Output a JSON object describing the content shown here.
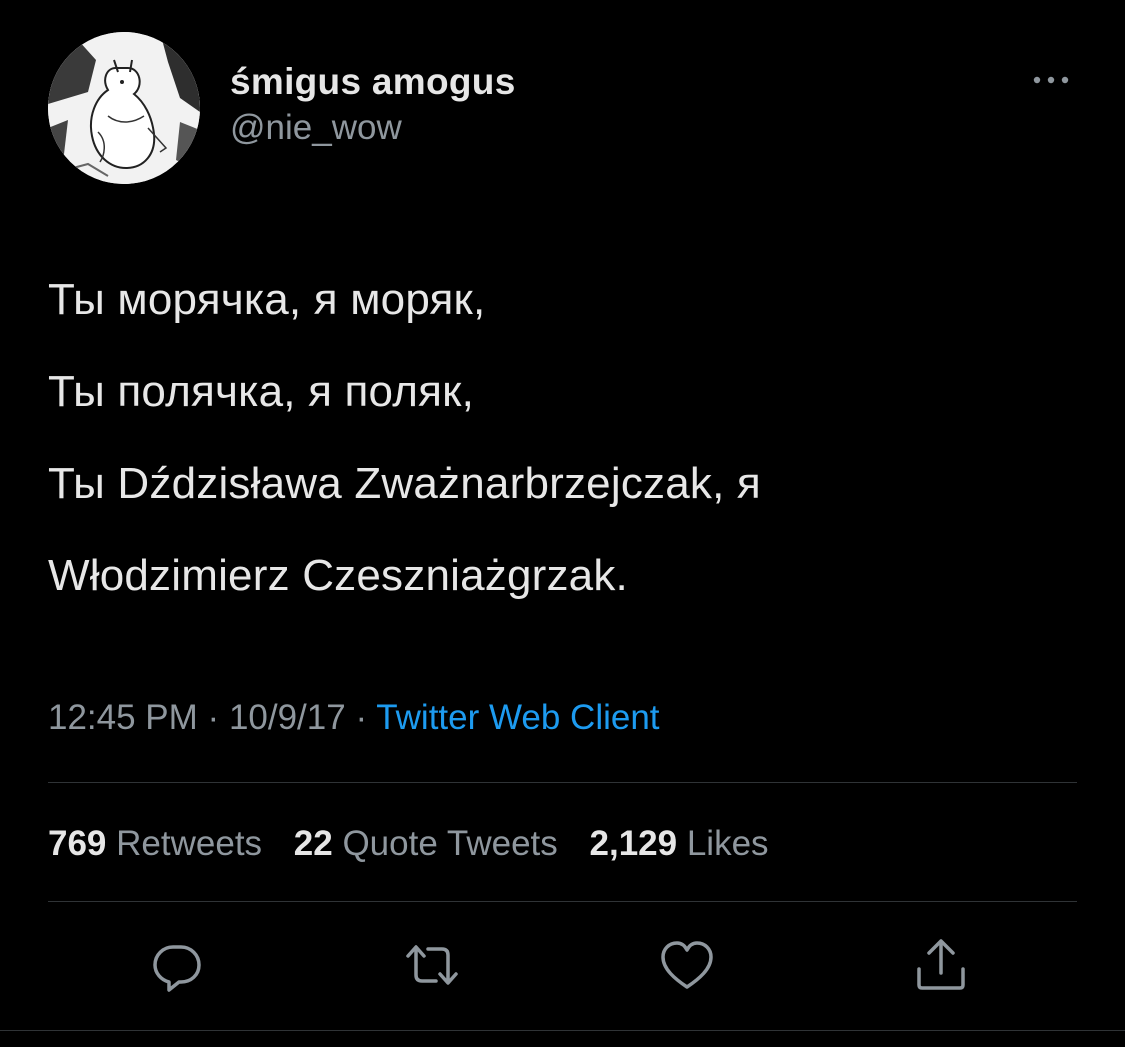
{
  "author": {
    "display_name": "śmigus amogus",
    "handle": "@nie_wow",
    "avatar_icon": "moomin-avatar-icon"
  },
  "tweet": {
    "lines": [
      "Ты морячка, я моряк,",
      "Ты полячка, я поляк,",
      "Ты Dździsława Zważnarbrzejczak, я",
      "Włodzimierz Czeszniażgrzak."
    ]
  },
  "meta": {
    "time": "12:45 PM",
    "separator_1": "·",
    "date": "10/9/17",
    "separator_2": "·",
    "source": "Twitter Web Client"
  },
  "stats": {
    "retweets_count": "769",
    "retweets_label": "Retweets",
    "quote_tweets_count": "22",
    "quote_tweets_label": "Quote Tweets",
    "likes_count": "2,129",
    "likes_label": "Likes"
  },
  "actions": {
    "reply_icon": "reply-icon",
    "retweet_icon": "retweet-icon",
    "like_icon": "heart-icon",
    "share_icon": "share-icon"
  },
  "colors": {
    "background": "#000000",
    "primary_text": "#e7e7e7",
    "secondary_text": "#8f979e",
    "link": "#1d9bf0",
    "divider": "#2f3336"
  }
}
